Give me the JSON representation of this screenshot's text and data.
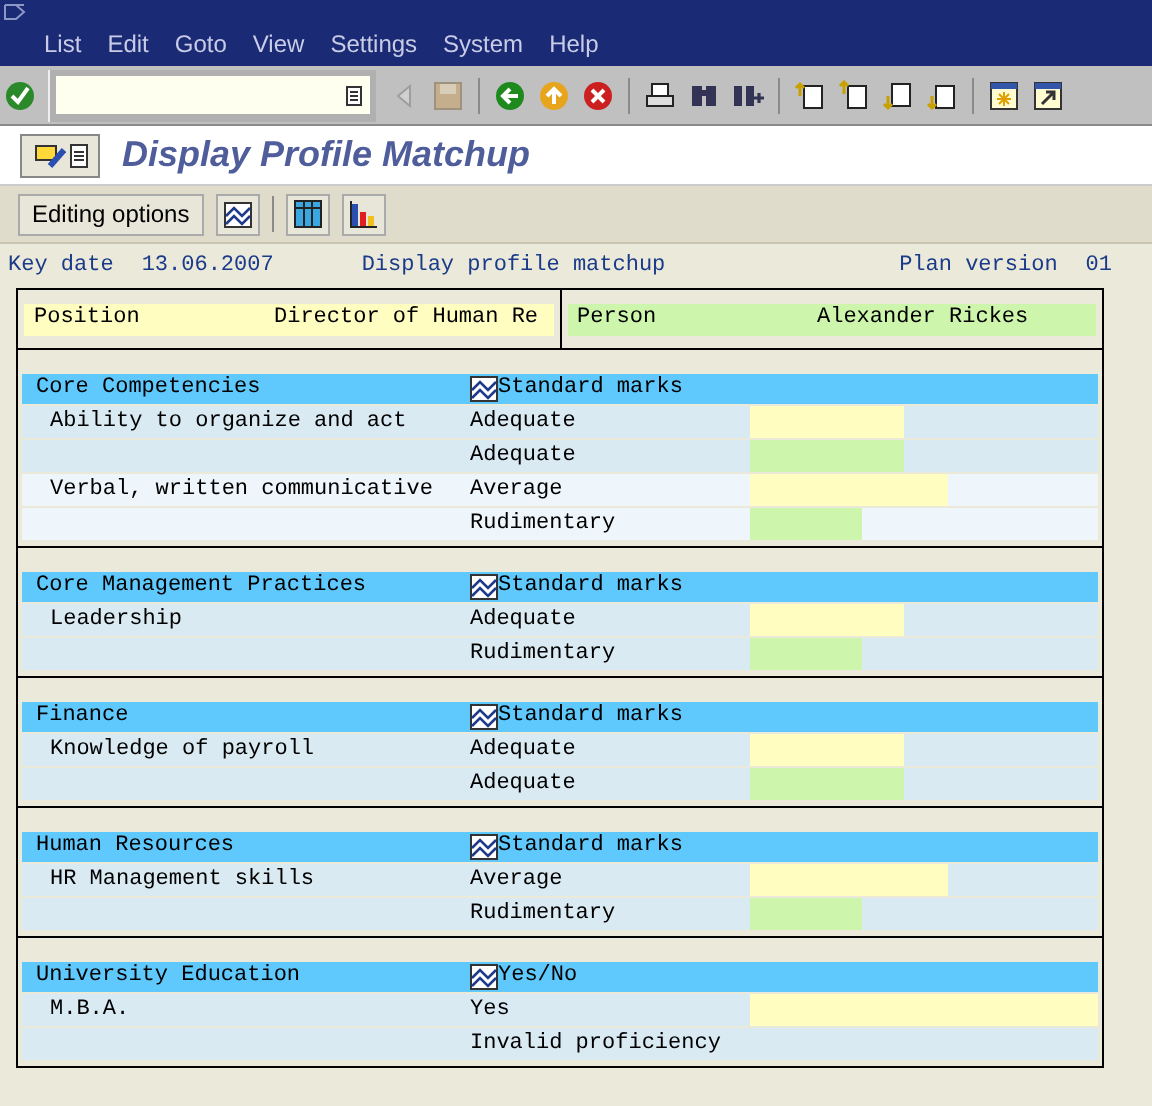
{
  "menu": [
    {
      "label": "List"
    },
    {
      "label": "Edit"
    },
    {
      "label": "Goto"
    },
    {
      "label": "View"
    },
    {
      "label": "Settings"
    },
    {
      "label": "System"
    },
    {
      "label": "Help"
    }
  ],
  "title": "Display Profile Matchup",
  "app_toolbar": {
    "editing_button": "Editing options"
  },
  "header": {
    "key_date_label": "Key date",
    "key_date": "13.06.2007",
    "heading": "Display profile matchup",
    "plan_version_label": "Plan version",
    "plan_version": "01"
  },
  "objects": [
    {
      "kind": "position",
      "label": "Position",
      "value": "Director of Human Re"
    },
    {
      "kind": "person",
      "label": "Person",
      "value": "Alexander Rickes"
    }
  ],
  "groups": [
    {
      "title": "Core Competencies",
      "scale": "Standard marks",
      "skills": [
        {
          "name": "Ability to organize and act",
          "rows": [
            {
              "kind": "required",
              "proficiency": "Adequate",
              "level": 0.44
            },
            {
              "kind": "actual",
              "proficiency": "Adequate",
              "level": 0.44
            }
          ]
        },
        {
          "name": "Verbal, written communicative",
          "rows": [
            {
              "kind": "required",
              "proficiency": "Average",
              "level": 0.57
            },
            {
              "kind": "actual",
              "proficiency": "Rudimentary",
              "level": 0.32
            }
          ]
        }
      ]
    },
    {
      "title": "Core Management Practices",
      "scale": "Standard marks",
      "skills": [
        {
          "name": "Leadership",
          "rows": [
            {
              "kind": "required",
              "proficiency": "Adequate",
              "level": 0.44
            },
            {
              "kind": "actual",
              "proficiency": "Rudimentary",
              "level": 0.32
            }
          ]
        }
      ]
    },
    {
      "title": "Finance",
      "scale": "Standard marks",
      "skills": [
        {
          "name": "Knowledge of payroll",
          "rows": [
            {
              "kind": "required",
              "proficiency": "Adequate",
              "level": 0.44
            },
            {
              "kind": "actual",
              "proficiency": "Adequate",
              "level": 0.44
            }
          ]
        }
      ]
    },
    {
      "title": "Human Resources",
      "scale": "Standard marks",
      "skills": [
        {
          "name": "HR Management skills",
          "rows": [
            {
              "kind": "required",
              "proficiency": "Average",
              "level": 0.57
            },
            {
              "kind": "actual",
              "proficiency": "Rudimentary",
              "level": 0.32
            }
          ]
        }
      ]
    },
    {
      "title": "University Education",
      "scale": "Yes/No",
      "skills": [
        {
          "name": "M.B.A.",
          "rows": [
            {
              "kind": "required",
              "proficiency": "Yes",
              "level": 1
            },
            {
              "kind": "actual",
              "proficiency": "Invalid proficiency"
            }
          ]
        }
      ]
    }
  ]
}
